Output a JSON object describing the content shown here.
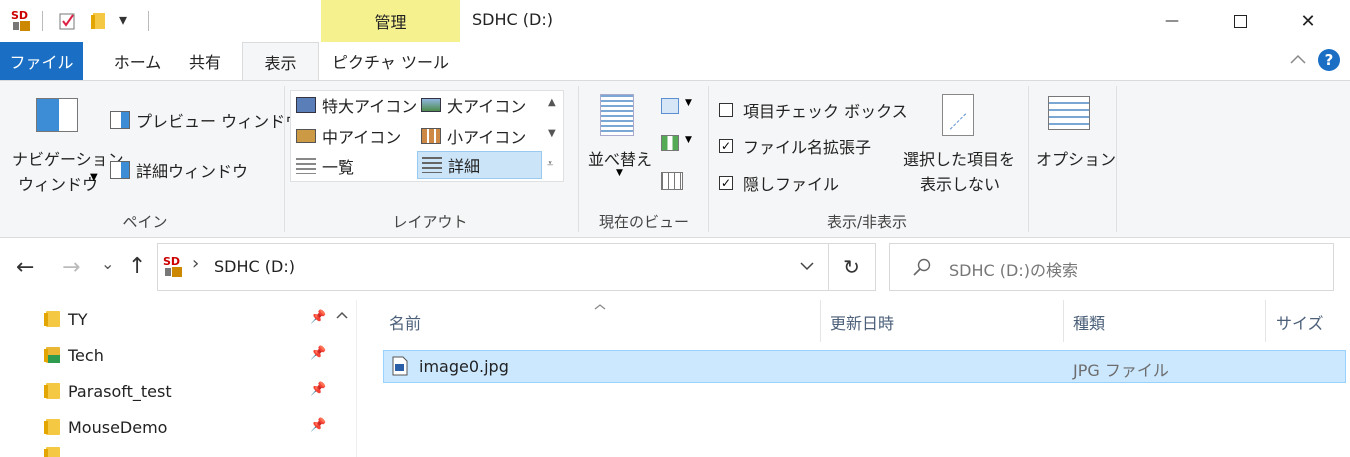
{
  "window": {
    "title": "SDHC (D:)",
    "context_tab_header": "管理",
    "qat_dropdown_glyph": "▾",
    "minimize_glyph": "—",
    "maximize_glyph": "☐",
    "close_glyph": "✕"
  },
  "tabs": [
    {
      "label": "ファイル"
    },
    {
      "label": "ホーム"
    },
    {
      "label": "共有"
    },
    {
      "label": "表示"
    },
    {
      "label": "ピクチャ ツール"
    }
  ],
  "ribbon": {
    "pane": {
      "nav_pane_line1": "ナビゲーション",
      "nav_pane_line2": "ウィンドウ",
      "preview_pane": "プレビュー ウィンドウ",
      "details_pane": "詳細ウィンドウ",
      "group_label": "ペイン"
    },
    "layout": {
      "items": [
        "特大アイコン",
        "大アイコン",
        "中アイコン",
        "小アイコン",
        "一覧",
        "詳細"
      ],
      "selected": "詳細",
      "group_label": "レイアウト"
    },
    "current_view": {
      "sort_by": "並べ替え",
      "group_label": "現在のビュー"
    },
    "show_hide": {
      "item_check_boxes": {
        "label": "項目チェック ボックス",
        "checked": false
      },
      "file_name_extensions": {
        "label": "ファイル名拡張子",
        "checked": true
      },
      "hidden_items": {
        "label": "隠しファイル",
        "checked": true
      },
      "hide_selected_line1": "選択した項目を",
      "hide_selected_line2": "表示しない",
      "group_label": "表示/非表示"
    },
    "options": {
      "label": "オプション"
    },
    "help_glyph": "?",
    "collapse_glyph": "^"
  },
  "navigation": {
    "back_glyph": "←",
    "forward_glyph": "→",
    "recent_glyph": "⌄",
    "up_glyph": "↑",
    "breadcrumb_sep": "›",
    "address": "SDHC (D:)",
    "refresh_glyph": "↻",
    "search_placeholder": "SDHC (D:)の検索"
  },
  "nav_pane": {
    "items": [
      {
        "label": "TY",
        "icon": "folder-icon"
      },
      {
        "label": "Tech",
        "icon": "download-folder-icon"
      },
      {
        "label": "Parasoft_test",
        "icon": "folder-icon"
      },
      {
        "label": "MouseDemo",
        "icon": "folder-icon"
      }
    ],
    "pin_glyph": "📌"
  },
  "file_list": {
    "columns": [
      "名前",
      "更新日時",
      "種類",
      "サイズ"
    ],
    "rows": [
      {
        "name": "image0.jpg",
        "modified": "",
        "type": "JPG ファイル",
        "size": ""
      }
    ]
  },
  "colors": {
    "file_tab": "#1a6fc4",
    "context_tab": "#f5f18f",
    "selection": "#cce8ff",
    "help": "#1a6fc4"
  }
}
